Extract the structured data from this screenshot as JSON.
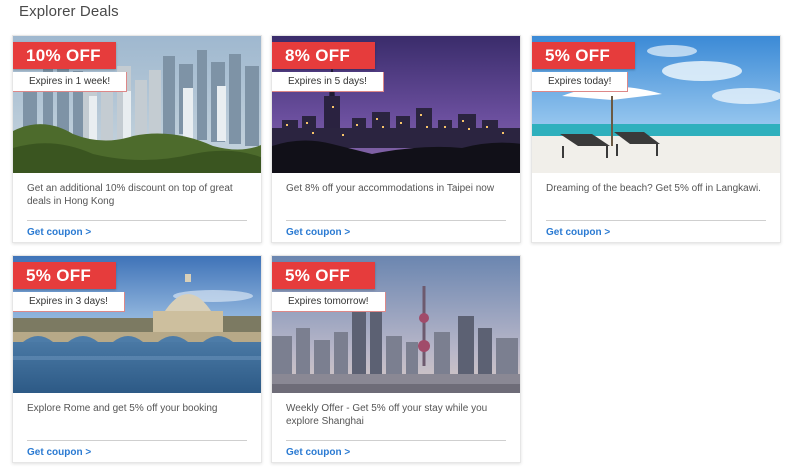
{
  "page": {
    "title": "Explorer Deals"
  },
  "deals": [
    {
      "discount": "10% OFF",
      "expiry": "Expires in 1 week!",
      "description": "Get an additional 10% discount on top of great deals in Hong Kong",
      "link": "Get coupon >",
      "image": "hong-kong-skyline"
    },
    {
      "discount": "8% OFF",
      "expiry": "Expires in 5 days!",
      "description": "Get 8% off your accommodations in Taipei now",
      "link": "Get coupon >",
      "image": "taipei-night-skyline"
    },
    {
      "discount": "5% OFF",
      "expiry": "Expires today!",
      "description": "Dreaming of the beach? Get 5% off in Langkawi.",
      "link": "Get coupon >",
      "image": "beach-loungers"
    },
    {
      "discount": "5% OFF",
      "expiry": "Expires in 3 days!",
      "description": "Explore Rome and get 5% off your booking",
      "link": "Get coupon >",
      "image": "rome-vatican-river"
    },
    {
      "discount": "5% OFF",
      "expiry": "Expires tomorrow!",
      "description": "Weekly Offer - Get 5% off your stay while you explore Shanghai",
      "link": "Get coupon >",
      "image": "shanghai-skyline"
    }
  ],
  "colors": {
    "badge": "#e63c3c",
    "link": "#2a7ad2",
    "title": "#4a4a4a"
  }
}
